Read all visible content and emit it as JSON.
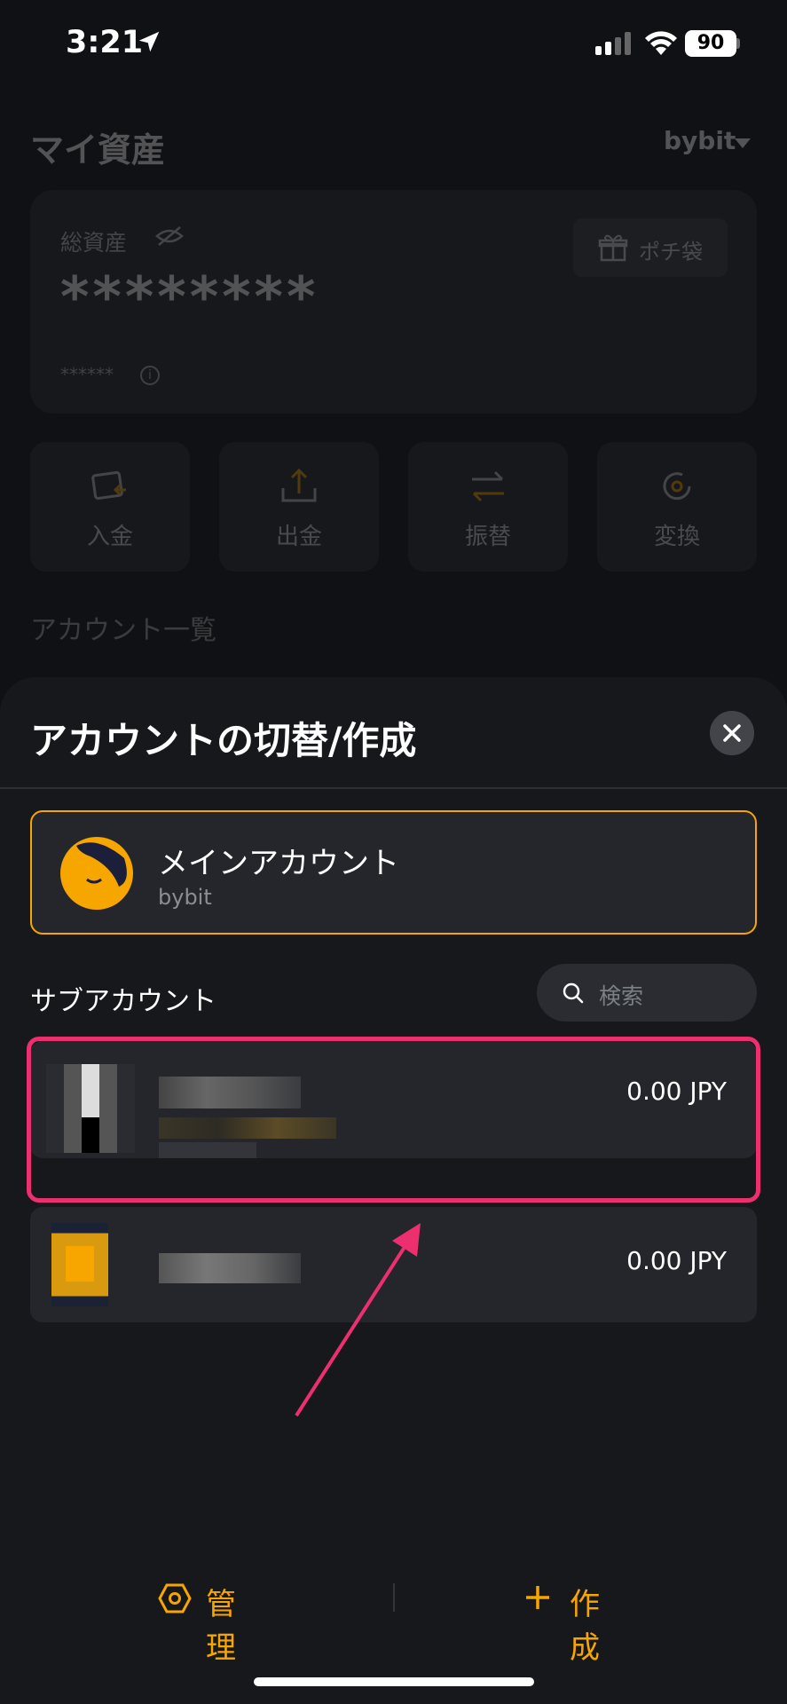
{
  "status_bar": {
    "time": "3:21",
    "battery": "90"
  },
  "background_page": {
    "title": "マイ資産",
    "exchange": "bybit",
    "total_assets_label": "総資産",
    "masked_balance": "********",
    "masked_sub_balance": "******",
    "gift_button_label": "ポチ袋",
    "actions": [
      {
        "label": "入金",
        "icon": "deposit-icon"
      },
      {
        "label": "出金",
        "icon": "withdraw-icon"
      },
      {
        "label": "振替",
        "icon": "transfer-icon"
      },
      {
        "label": "変換",
        "icon": "convert-icon"
      }
    ],
    "accounts_section_title": "アカウント一覧"
  },
  "sheet": {
    "title": "アカウントの切替/作成",
    "main_account": {
      "name": "メインアカウント",
      "exchange": "bybit"
    },
    "sub_accounts_label": "サブアカウント",
    "search_placeholder": "検索",
    "sub_accounts": [
      {
        "amount": "0.00 JPY"
      },
      {
        "amount": "0.00 JPY"
      }
    ],
    "manage_label": "管理",
    "create_label": "作成"
  },
  "colors": {
    "accent": "#f7a600",
    "highlight": "#ec2f6e",
    "sheet_bg": "#17181c",
    "card_bg": "#24262b"
  }
}
